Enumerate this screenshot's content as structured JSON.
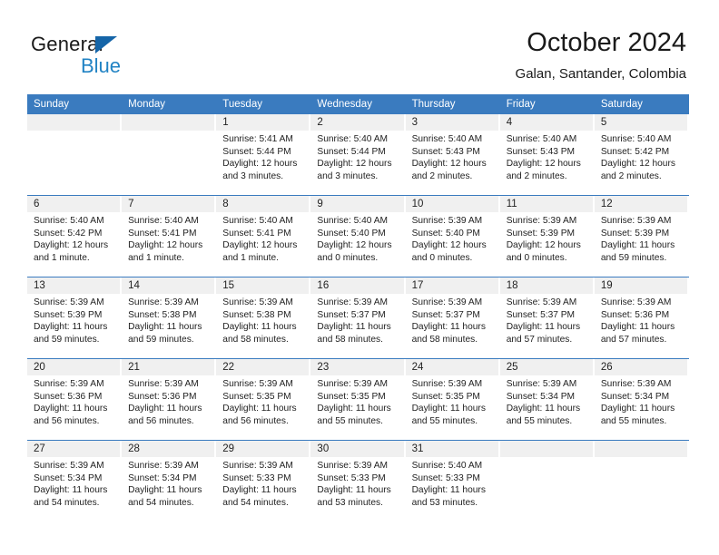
{
  "brand": {
    "name_part1": "General",
    "name_part2": "Blue",
    "triangle_icon": "blue-triangle-logo-mark",
    "color_dark": "#1a1a1a",
    "color_blue": "#2183c4"
  },
  "header": {
    "title": "October 2024",
    "subtitle": "Galan, Santander, Colombia"
  },
  "theme": {
    "header_row_bg": "#3a7bbf",
    "daynum_bg": "#f0f0f0",
    "row_separator": "#3a7bbf",
    "text": "#222222"
  },
  "weekday_headers": [
    "Sunday",
    "Monday",
    "Tuesday",
    "Wednesday",
    "Thursday",
    "Friday",
    "Saturday"
  ],
  "labels": {
    "sunrise_prefix": "Sunrise:",
    "sunset_prefix": "Sunset:",
    "daylight_prefix": "Daylight:"
  },
  "weeks": [
    [
      {
        "day": "",
        "empty": true
      },
      {
        "day": "",
        "empty": true
      },
      {
        "day": "1",
        "sunrise": "Sunrise: 5:41 AM",
        "sunset": "Sunset: 5:44 PM",
        "daylight_line1": "Daylight: 12 hours",
        "daylight_line2": "and 3 minutes."
      },
      {
        "day": "2",
        "sunrise": "Sunrise: 5:40 AM",
        "sunset": "Sunset: 5:44 PM",
        "daylight_line1": "Daylight: 12 hours",
        "daylight_line2": "and 3 minutes."
      },
      {
        "day": "3",
        "sunrise": "Sunrise: 5:40 AM",
        "sunset": "Sunset: 5:43 PM",
        "daylight_line1": "Daylight: 12 hours",
        "daylight_line2": "and 2 minutes."
      },
      {
        "day": "4",
        "sunrise": "Sunrise: 5:40 AM",
        "sunset": "Sunset: 5:43 PM",
        "daylight_line1": "Daylight: 12 hours",
        "daylight_line2": "and 2 minutes."
      },
      {
        "day": "5",
        "sunrise": "Sunrise: 5:40 AM",
        "sunset": "Sunset: 5:42 PM",
        "daylight_line1": "Daylight: 12 hours",
        "daylight_line2": "and 2 minutes."
      }
    ],
    [
      {
        "day": "6",
        "sunrise": "Sunrise: 5:40 AM",
        "sunset": "Sunset: 5:42 PM",
        "daylight_line1": "Daylight: 12 hours",
        "daylight_line2": "and 1 minute."
      },
      {
        "day": "7",
        "sunrise": "Sunrise: 5:40 AM",
        "sunset": "Sunset: 5:41 PM",
        "daylight_line1": "Daylight: 12 hours",
        "daylight_line2": "and 1 minute."
      },
      {
        "day": "8",
        "sunrise": "Sunrise: 5:40 AM",
        "sunset": "Sunset: 5:41 PM",
        "daylight_line1": "Daylight: 12 hours",
        "daylight_line2": "and 1 minute."
      },
      {
        "day": "9",
        "sunrise": "Sunrise: 5:40 AM",
        "sunset": "Sunset: 5:40 PM",
        "daylight_line1": "Daylight: 12 hours",
        "daylight_line2": "and 0 minutes."
      },
      {
        "day": "10",
        "sunrise": "Sunrise: 5:39 AM",
        "sunset": "Sunset: 5:40 PM",
        "daylight_line1": "Daylight: 12 hours",
        "daylight_line2": "and 0 minutes."
      },
      {
        "day": "11",
        "sunrise": "Sunrise: 5:39 AM",
        "sunset": "Sunset: 5:39 PM",
        "daylight_line1": "Daylight: 12 hours",
        "daylight_line2": "and 0 minutes."
      },
      {
        "day": "12",
        "sunrise": "Sunrise: 5:39 AM",
        "sunset": "Sunset: 5:39 PM",
        "daylight_line1": "Daylight: 11 hours",
        "daylight_line2": "and 59 minutes."
      }
    ],
    [
      {
        "day": "13",
        "sunrise": "Sunrise: 5:39 AM",
        "sunset": "Sunset: 5:39 PM",
        "daylight_line1": "Daylight: 11 hours",
        "daylight_line2": "and 59 minutes."
      },
      {
        "day": "14",
        "sunrise": "Sunrise: 5:39 AM",
        "sunset": "Sunset: 5:38 PM",
        "daylight_line1": "Daylight: 11 hours",
        "daylight_line2": "and 59 minutes."
      },
      {
        "day": "15",
        "sunrise": "Sunrise: 5:39 AM",
        "sunset": "Sunset: 5:38 PM",
        "daylight_line1": "Daylight: 11 hours",
        "daylight_line2": "and 58 minutes."
      },
      {
        "day": "16",
        "sunrise": "Sunrise: 5:39 AM",
        "sunset": "Sunset: 5:37 PM",
        "daylight_line1": "Daylight: 11 hours",
        "daylight_line2": "and 58 minutes."
      },
      {
        "day": "17",
        "sunrise": "Sunrise: 5:39 AM",
        "sunset": "Sunset: 5:37 PM",
        "daylight_line1": "Daylight: 11 hours",
        "daylight_line2": "and 58 minutes."
      },
      {
        "day": "18",
        "sunrise": "Sunrise: 5:39 AM",
        "sunset": "Sunset: 5:37 PM",
        "daylight_line1": "Daylight: 11 hours",
        "daylight_line2": "and 57 minutes."
      },
      {
        "day": "19",
        "sunrise": "Sunrise: 5:39 AM",
        "sunset": "Sunset: 5:36 PM",
        "daylight_line1": "Daylight: 11 hours",
        "daylight_line2": "and 57 minutes."
      }
    ],
    [
      {
        "day": "20",
        "sunrise": "Sunrise: 5:39 AM",
        "sunset": "Sunset: 5:36 PM",
        "daylight_line1": "Daylight: 11 hours",
        "daylight_line2": "and 56 minutes."
      },
      {
        "day": "21",
        "sunrise": "Sunrise: 5:39 AM",
        "sunset": "Sunset: 5:36 PM",
        "daylight_line1": "Daylight: 11 hours",
        "daylight_line2": "and 56 minutes."
      },
      {
        "day": "22",
        "sunrise": "Sunrise: 5:39 AM",
        "sunset": "Sunset: 5:35 PM",
        "daylight_line1": "Daylight: 11 hours",
        "daylight_line2": "and 56 minutes."
      },
      {
        "day": "23",
        "sunrise": "Sunrise: 5:39 AM",
        "sunset": "Sunset: 5:35 PM",
        "daylight_line1": "Daylight: 11 hours",
        "daylight_line2": "and 55 minutes."
      },
      {
        "day": "24",
        "sunrise": "Sunrise: 5:39 AM",
        "sunset": "Sunset: 5:35 PM",
        "daylight_line1": "Daylight: 11 hours",
        "daylight_line2": "and 55 minutes."
      },
      {
        "day": "25",
        "sunrise": "Sunrise: 5:39 AM",
        "sunset": "Sunset: 5:34 PM",
        "daylight_line1": "Daylight: 11 hours",
        "daylight_line2": "and 55 minutes."
      },
      {
        "day": "26",
        "sunrise": "Sunrise: 5:39 AM",
        "sunset": "Sunset: 5:34 PM",
        "daylight_line1": "Daylight: 11 hours",
        "daylight_line2": "and 55 minutes."
      }
    ],
    [
      {
        "day": "27",
        "sunrise": "Sunrise: 5:39 AM",
        "sunset": "Sunset: 5:34 PM",
        "daylight_line1": "Daylight: 11 hours",
        "daylight_line2": "and 54 minutes."
      },
      {
        "day": "28",
        "sunrise": "Sunrise: 5:39 AM",
        "sunset": "Sunset: 5:34 PM",
        "daylight_line1": "Daylight: 11 hours",
        "daylight_line2": "and 54 minutes."
      },
      {
        "day": "29",
        "sunrise": "Sunrise: 5:39 AM",
        "sunset": "Sunset: 5:33 PM",
        "daylight_line1": "Daylight: 11 hours",
        "daylight_line2": "and 54 minutes."
      },
      {
        "day": "30",
        "sunrise": "Sunrise: 5:39 AM",
        "sunset": "Sunset: 5:33 PM",
        "daylight_line1": "Daylight: 11 hours",
        "daylight_line2": "and 53 minutes."
      },
      {
        "day": "31",
        "sunrise": "Sunrise: 5:40 AM",
        "sunset": "Sunset: 5:33 PM",
        "daylight_line1": "Daylight: 11 hours",
        "daylight_line2": "and 53 minutes."
      },
      {
        "day": "",
        "empty": true
      },
      {
        "day": "",
        "empty": true
      }
    ]
  ]
}
